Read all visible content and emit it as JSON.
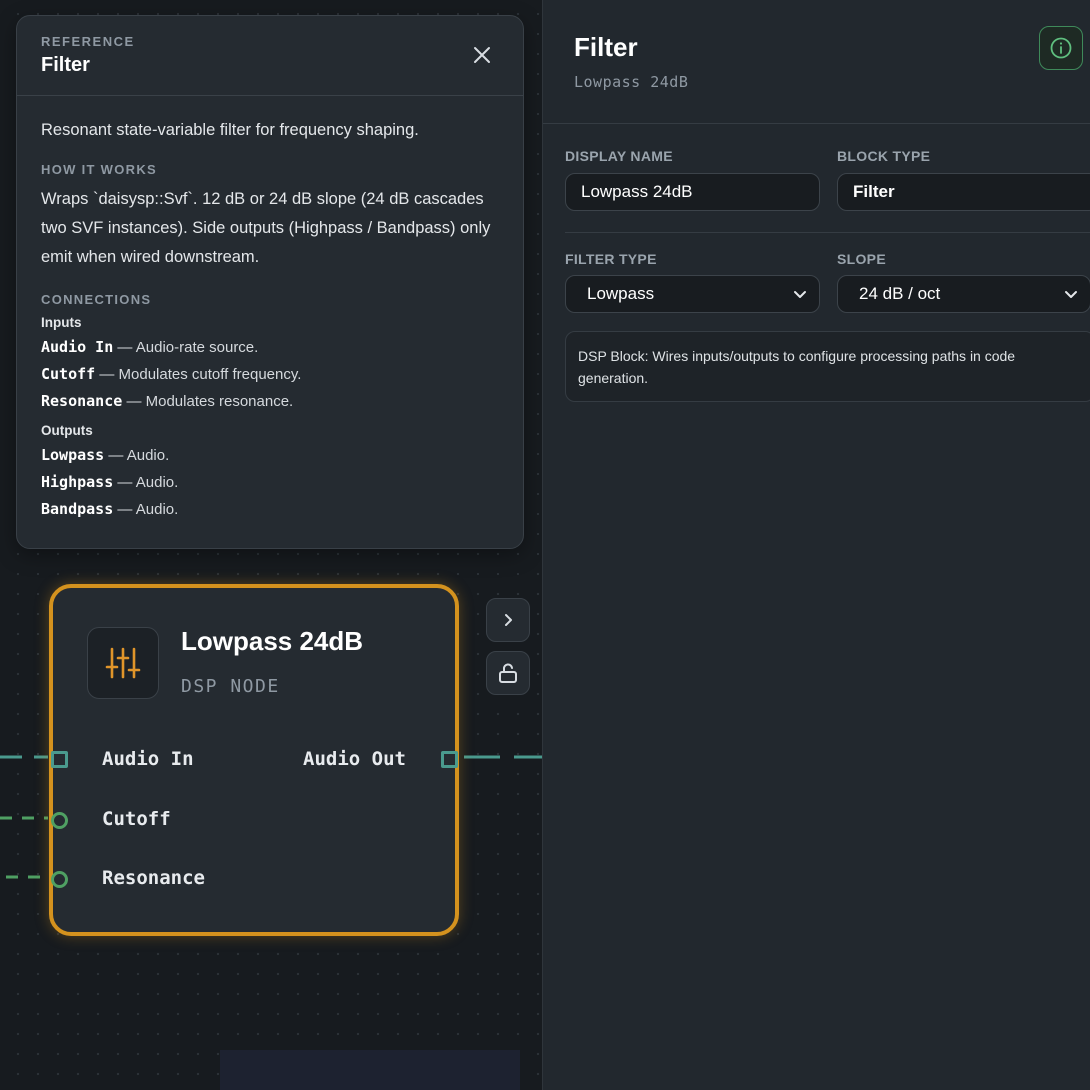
{
  "reference": {
    "eyebrow": "REFERENCE",
    "title": "Filter",
    "description": "Resonant state-variable filter for frequency shaping.",
    "how_label": "HOW IT WORKS",
    "how_text": "Wraps `daisysp::Svf`. 12 dB or 24 dB slope (24 dB cascades two SVF instances). Side outputs (Highpass / Bandpass) only emit when wired downstream.",
    "connections_label": "CONNECTIONS",
    "inputs_label": "Inputs",
    "inputs": [
      {
        "name": "Audio In",
        "desc": " — Audio-rate source."
      },
      {
        "name": "Cutoff",
        "desc": " — Modulates cutoff frequency."
      },
      {
        "name": "Resonance",
        "desc": " — Modulates resonance."
      }
    ],
    "outputs_label": "Outputs",
    "outputs": [
      {
        "name": "Lowpass",
        "desc": " — Audio."
      },
      {
        "name": "Highpass",
        "desc": " — Audio."
      },
      {
        "name": "Bandpass",
        "desc": " — Audio."
      }
    ]
  },
  "node": {
    "title": "Lowpass 24dB",
    "subtitle": "DSP NODE",
    "inputs": [
      "Audio In",
      "Cutoff",
      "Resonance"
    ],
    "outputs": [
      "Audio Out"
    ],
    "accent_color": "#d4921e",
    "icon": "sliders-icon"
  },
  "side_buttons": {
    "expand_icon": "chevron-right-icon",
    "lock_icon": "unlock-icon"
  },
  "panel": {
    "title": "Filter",
    "subtitle": "Lowpass 24dB",
    "info_icon": "info-icon",
    "display_name_label": "DISPLAY NAME",
    "display_name_value": "Lowpass 24dB",
    "block_type_label": "BLOCK TYPE",
    "block_type_value": "Filter",
    "filter_type_label": "FILTER TYPE",
    "filter_type_value": "Lowpass",
    "slope_label": "SLOPE",
    "slope_value": "24 dB / oct",
    "note": "DSP Block: Wires inputs/outputs to configure processing paths in code generation."
  },
  "colors": {
    "audio_wire": "#4a9a8e",
    "mod_wire": "#4fa063",
    "info_accent": "#5fbf7f"
  }
}
